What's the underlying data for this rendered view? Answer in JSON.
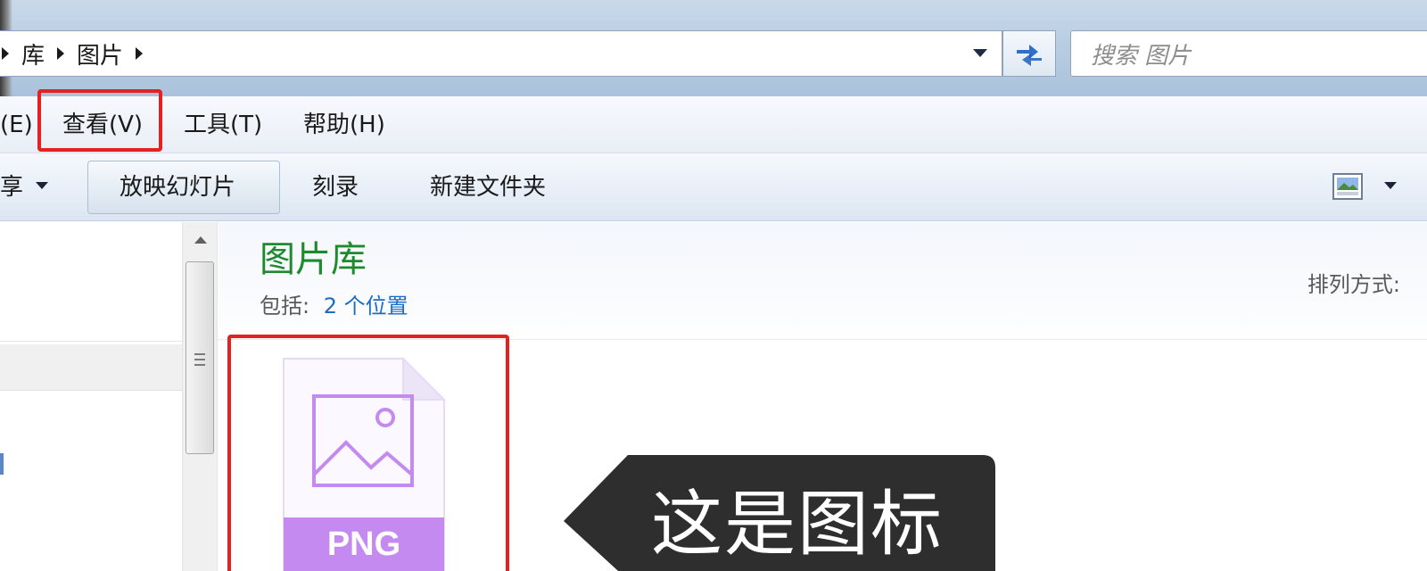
{
  "address": {
    "breadcrumbs": [
      "库",
      "图片"
    ],
    "search_placeholder": "搜索 图片"
  },
  "menu": {
    "edit_partial": "(E)",
    "view": "查看(V)",
    "tools": "工具(T)",
    "help": "帮助(H)"
  },
  "toolbar": {
    "share_partial": "享",
    "slideshow": "放映幻灯片",
    "burn": "刻录",
    "new_folder": "新建文件夹"
  },
  "library": {
    "title": "图片库",
    "includes_label": "包括:",
    "includes_link": "2 个位置",
    "arrange_label": "排列方式:"
  },
  "file": {
    "type_label": "PNG"
  },
  "annotation": {
    "callout_text": "这是图标"
  },
  "colors": {
    "highlight": "#e5211f",
    "library_title": "#1e8a2e",
    "link": "#1a6cc4",
    "png_badge": "#c58af0",
    "callout": "#2e2e2e"
  }
}
